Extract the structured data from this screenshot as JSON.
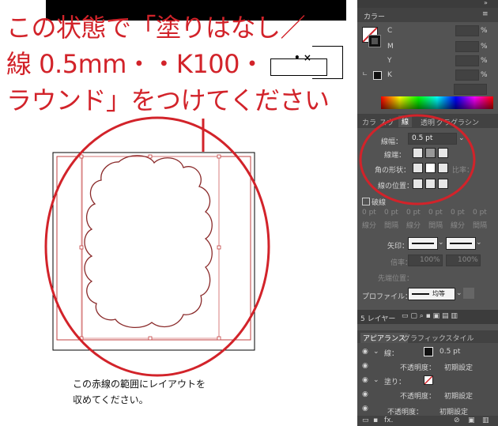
{
  "callout": {
    "line1": "この状態で「塗りはなし／",
    "line2": "線 0.5mm・・K100・",
    "line3": "ラウンド」をつけてください"
  },
  "instruction": {
    "line1": "この赤線の範囲にレイアウトを",
    "line2": "収めてください。"
  },
  "color_panel": {
    "title": "カラー",
    "channels": [
      {
        "label": "C",
        "unit": "%"
      },
      {
        "label": "M",
        "unit": "%"
      },
      {
        "label": "Y",
        "unit": "%"
      },
      {
        "label": "K",
        "unit": "%"
      }
    ]
  },
  "stroke_panel": {
    "tabs": [
      "カラ",
      "スウ",
      "線",
      "透明",
      "グラ",
      "グラ",
      "シン"
    ],
    "weight_label": "線幅：",
    "weight_value": "0.5 pt",
    "cap_label": "線端：",
    "corner_label": "角の形状：",
    "limit_label": "比率：",
    "align_label": "線の位置：",
    "dashed_label": "破線",
    "dash_headers": [
      "線分",
      "間隔",
      "線分",
      "間隔",
      "線分",
      "間隔"
    ],
    "dash_value": "0 pt",
    "arrow_label": "矢印：",
    "scale_label": "倍率：",
    "scale_value_1": "100%",
    "scale_value_2": "100%",
    "align_arrow_label": "先端位置：",
    "profile_label": "プロファイル：",
    "profile_value": "均等"
  },
  "layers_bar": {
    "label": "5 レイヤー"
  },
  "appearance_panel": {
    "tabs": [
      "アピアランス",
      "グラフィックスタイル"
    ],
    "rows": [
      {
        "label": "線：",
        "value": "0.5 pt"
      },
      {
        "label": "不透明度：",
        "value": "初期設定"
      },
      {
        "label": "塗り：",
        "value": ""
      },
      {
        "label": "不透明度：",
        "value": "初期設定"
      },
      {
        "label": "不透明度：",
        "value": "初期設定"
      }
    ],
    "fx_label": "fx."
  },
  "colors": {
    "accent_red": "#d2232a",
    "panel_bg": "#535353",
    "panel_dark": "#3c3c3c"
  }
}
